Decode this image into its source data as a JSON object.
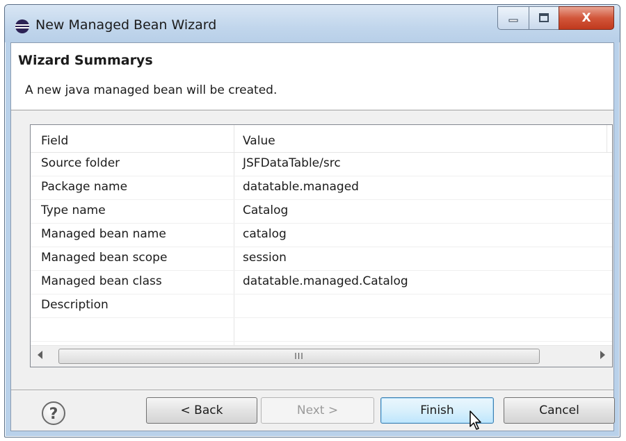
{
  "window": {
    "title": "New Managed Bean Wizard",
    "close_glyph": "X"
  },
  "wizard": {
    "title": "Wizard Summarys",
    "description": "A new java managed bean will be created."
  },
  "table": {
    "columns": [
      "Field",
      "Value"
    ],
    "rows": [
      {
        "field": "Source folder",
        "value": "JSFDataTable/src"
      },
      {
        "field": "Package name",
        "value": "datatable.managed"
      },
      {
        "field": "Type name",
        "value": "Catalog"
      },
      {
        "field": "Managed bean name",
        "value": "catalog"
      },
      {
        "field": "Managed bean scope",
        "value": "session"
      },
      {
        "field": "Managed bean class",
        "value": "datatable.managed.Catalog"
      },
      {
        "field": "Description",
        "value": ""
      }
    ],
    "scroll_grip": "III"
  },
  "buttons": {
    "help": "?",
    "back": "< Back",
    "next": "Next >",
    "finish": "Finish",
    "cancel": "Cancel"
  },
  "icons": {
    "app": "eclipse-icon",
    "help": "help-icon",
    "cursor": "mouse-pointer-icon"
  }
}
